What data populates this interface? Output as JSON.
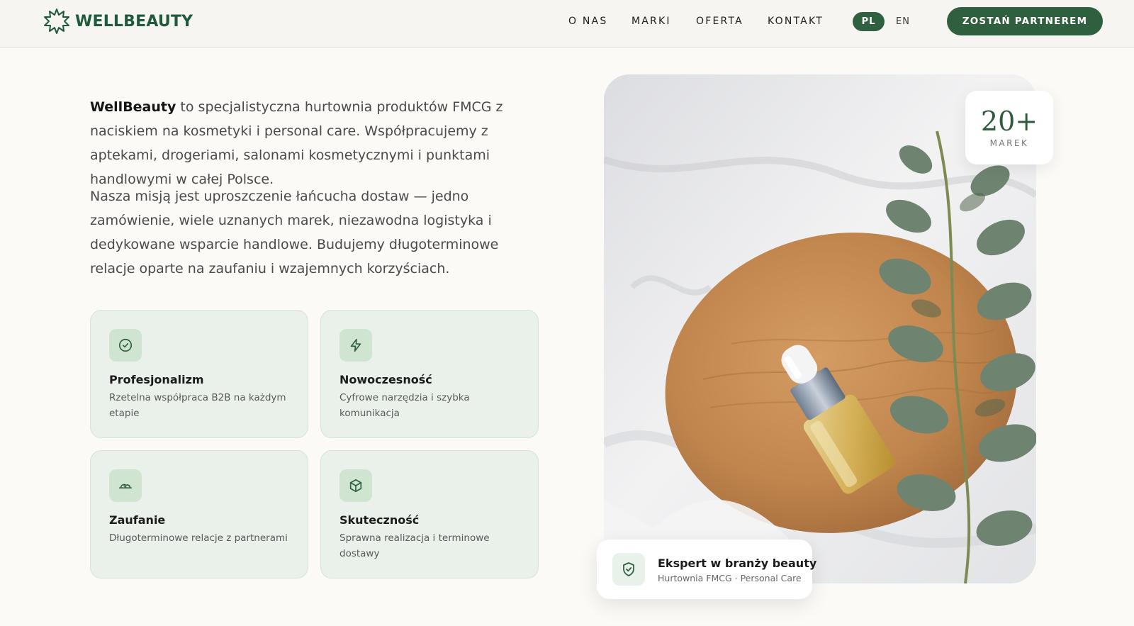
{
  "brand": {
    "name": "WELLBEAUTY",
    "color": "#1f5a3d"
  },
  "nav": {
    "items": [
      "O NAS",
      "MARKI",
      "OFERTA",
      "KONTAKT"
    ],
    "lang_active": "PL",
    "lang_other": "EN",
    "cta": "ZOSTAŃ PARTNEREM"
  },
  "intro": {
    "brand_bold": "WellBeauty",
    "p1_rest": " to specjalistyczna hurtownia produktów FMCG z naciskiem na kosmetyki i personal care. Współpracujemy z aptekami, drogeriami, salonami kosmetycznymi i punktami handlowymi w całej Polsce.",
    "p2": "Nasza misją jest uproszczenie łańcucha dostaw — jedno zamówienie, wiele uznanych marek, niezawodna logistyka i dedykowane wsparcie handlowe. Budujemy długoterminowe relacje oparte na zaufaniu i wzajemnych korzyściach."
  },
  "features": [
    {
      "icon": "check-circle-icon",
      "title": "Profesjonalizm",
      "desc": "Rzetelna współpraca B2B na każdym etapie"
    },
    {
      "icon": "lightning-icon",
      "title": "Nowoczesność",
      "desc": "Cyfrowe narzędzia i szybka komunikacja"
    },
    {
      "icon": "handshake-icon",
      "title": "Zaufanie",
      "desc": "Długoterminowe relacje z partnerami"
    },
    {
      "icon": "box-icon",
      "title": "Skuteczność",
      "desc": "Sprawna realizacja i terminowe dostawy"
    }
  ],
  "stat": {
    "value": "20+",
    "label": "MAREK"
  },
  "badge": {
    "icon": "shield-check-icon",
    "title": "Ekspert w branży beauty",
    "subtitle": "Hurtownia FMCG · Personal Care"
  },
  "colors": {
    "accent": "#2e5f3e",
    "card_bg": "#e9f1ea",
    "page_bg": "#fbfaf7"
  }
}
